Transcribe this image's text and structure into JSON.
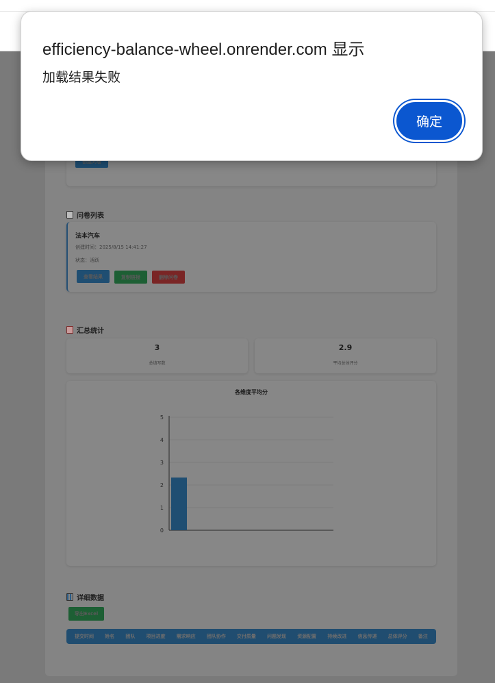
{
  "dialog": {
    "title": "efficiency-balance-wheel.onrender.com 显示",
    "message": "加载结果失败",
    "ok_label": "确定"
  },
  "top_panel": {
    "button_label": "创建问卷"
  },
  "questionnaire_list": {
    "title": "问卷列表",
    "items": [
      {
        "name": "法本汽车",
        "created": "创建时间：2025/8/15 14:41:27",
        "status": "状态：活跃",
        "view_label": "查看结果",
        "copy_label": "复制链接",
        "delete_label": "删除问卷"
      }
    ]
  },
  "summary": {
    "title": "汇总统计",
    "stats": [
      {
        "value": "3",
        "label": "总填写数"
      },
      {
        "value": "2.9",
        "label": "平均总体评分"
      }
    ]
  },
  "chart_data": {
    "type": "bar",
    "title": "各维度平均分",
    "ylim": [
      0,
      5
    ],
    "yticks": [
      "0",
      "1",
      "2",
      "3",
      "4",
      "5"
    ],
    "categories": [
      ""
    ],
    "values": [
      2.33
    ],
    "colors": {
      "bar": "#1f4e72"
    },
    "grid": true
  },
  "details": {
    "title": "详细数据",
    "export_label": "导出Excel",
    "columns": [
      "提交时间",
      "姓名",
      "团队",
      "项目进度",
      "需求响应",
      "团队协作",
      "交付质量",
      "问题发现",
      "资源配置",
      "持续改进",
      "信息传递",
      "总体评分",
      "备注"
    ]
  }
}
